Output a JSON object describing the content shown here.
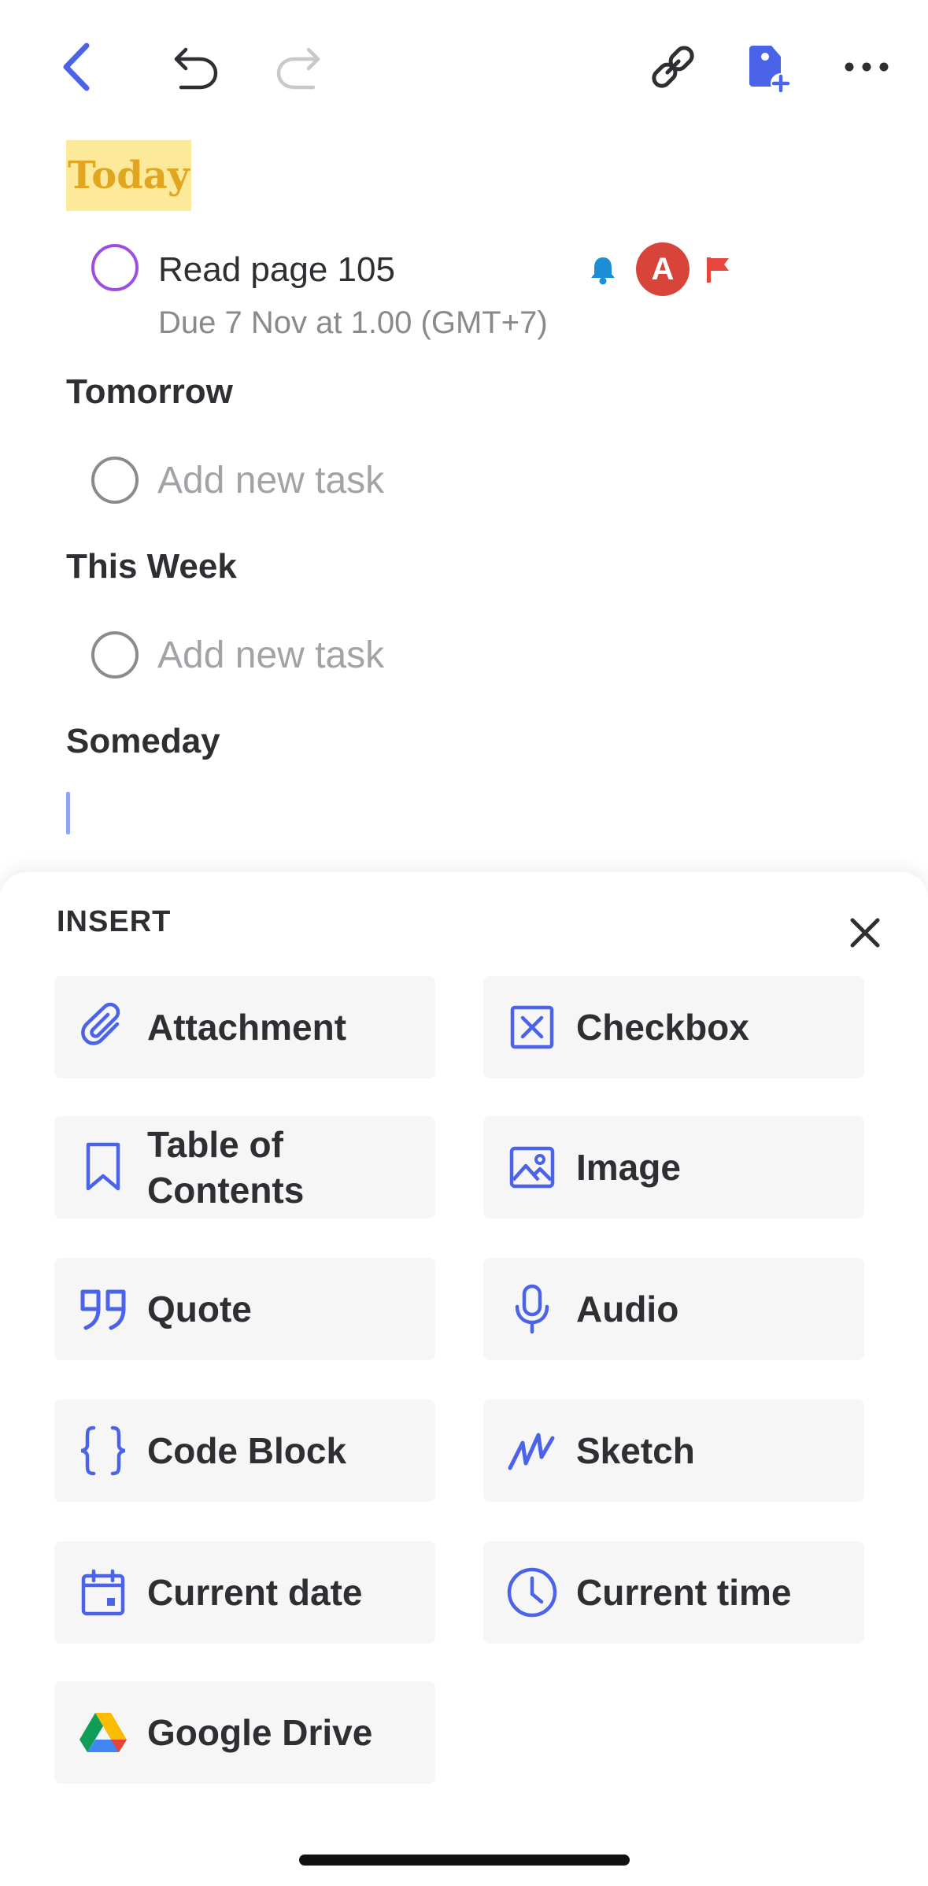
{
  "note": {
    "sections": [
      {
        "heading": "Today"
      },
      {
        "heading": "Tomorrow"
      },
      {
        "heading": "This Week"
      },
      {
        "heading": "Someday"
      }
    ],
    "task": {
      "title": "Read page 105",
      "due": "Due 7 Nov at 1.00 (GMT+7)",
      "assignee_initial": "A"
    },
    "new_task_placeholder": "Add new task"
  },
  "insert_sheet": {
    "title": "INSERT",
    "items": [
      {
        "label": "Attachment",
        "icon": "paperclip-icon"
      },
      {
        "label": "Checkbox",
        "icon": "checkbox-icon"
      },
      {
        "label": "Table of\nContents",
        "icon": "bookmark-icon"
      },
      {
        "label": "Image",
        "icon": "image-icon"
      },
      {
        "label": "Quote",
        "icon": "quote-icon"
      },
      {
        "label": "Audio",
        "icon": "microphone-icon"
      },
      {
        "label": "Code Block",
        "icon": "code-braces-icon"
      },
      {
        "label": "Sketch",
        "icon": "sketch-icon"
      },
      {
        "label": "Current date",
        "icon": "calendar-icon"
      },
      {
        "label": "Current time",
        "icon": "clock-icon"
      },
      {
        "label": "Google Drive",
        "icon": "google-drive-icon"
      }
    ]
  },
  "colors": {
    "accent": "#4a63e8",
    "highlight": "#fde99a",
    "today_text": "#e0a620",
    "avatar": "#d9443a",
    "flag": "#e8453c",
    "bell": "#1b8ed6",
    "task_circle": "#9e4fe0"
  }
}
